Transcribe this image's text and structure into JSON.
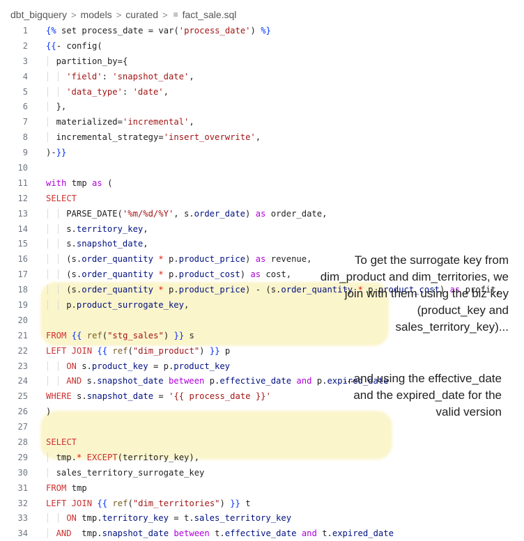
{
  "breadcrumb": {
    "items": [
      "dbt_bigquery",
      "models",
      "curated"
    ],
    "separator": ">",
    "file_icon": "≡",
    "file": "fact_sale.sql"
  },
  "code_lines": [
    {
      "n": "1",
      "indent": 0,
      "tokens": [
        [
          "t-br",
          "{%"
        ],
        [
          "t-plain",
          " set process_date = var("
        ],
        [
          "t-str",
          "'process_date'"
        ],
        [
          "t-plain",
          ") "
        ],
        [
          "t-br",
          "%}"
        ]
      ]
    },
    {
      "n": "2",
      "indent": 0,
      "tokens": [
        [
          "t-br",
          "{{"
        ],
        [
          "t-plain",
          "- config("
        ]
      ]
    },
    {
      "n": "3",
      "indent": 1,
      "tokens": [
        [
          "t-plain",
          "partition_by={"
        ]
      ]
    },
    {
      "n": "4",
      "indent": 2,
      "tokens": [
        [
          "t-str",
          "'field'"
        ],
        [
          "t-plain",
          ": "
        ],
        [
          "t-str",
          "'snapshot_date'"
        ],
        [
          "t-plain",
          ","
        ]
      ]
    },
    {
      "n": "5",
      "indent": 2,
      "tokens": [
        [
          "t-str",
          "'data_type'"
        ],
        [
          "t-plain",
          ": "
        ],
        [
          "t-str",
          "'date'"
        ],
        [
          "t-plain",
          ","
        ]
      ]
    },
    {
      "n": "6",
      "indent": 1,
      "tokens": [
        [
          "t-plain",
          "},"
        ]
      ]
    },
    {
      "n": "7",
      "indent": 1,
      "tokens": [
        [
          "t-plain",
          "materialized="
        ],
        [
          "t-str",
          "'incremental'"
        ],
        [
          "t-plain",
          ","
        ]
      ]
    },
    {
      "n": "8",
      "indent": 1,
      "tokens": [
        [
          "t-plain",
          "incremental_strategy="
        ],
        [
          "t-str",
          "'insert_overwrite'"
        ],
        [
          "t-plain",
          ","
        ]
      ]
    },
    {
      "n": "9",
      "indent": 0,
      "tokens": [
        [
          "t-plain",
          ")-"
        ],
        [
          "t-br",
          "}}"
        ]
      ]
    },
    {
      "n": "10",
      "indent": 0,
      "tokens": []
    },
    {
      "n": "11",
      "indent": 0,
      "tokens": [
        [
          "t-kw",
          "with"
        ],
        [
          "t-plain",
          " tmp "
        ],
        [
          "t-kw",
          "as"
        ],
        [
          "t-plain",
          " ("
        ]
      ]
    },
    {
      "n": "12",
      "indent": 0,
      "tokens": [
        [
          "t-red",
          "SELECT"
        ]
      ]
    },
    {
      "n": "13",
      "indent": 2,
      "tokens": [
        [
          "t-plain",
          "PARSE_DATE("
        ],
        [
          "t-str",
          "'%m/%d/%Y'"
        ],
        [
          "t-plain",
          ", s."
        ],
        [
          "t-var",
          "order_date"
        ],
        [
          "t-plain",
          ") "
        ],
        [
          "t-kw",
          "as"
        ],
        [
          "t-plain",
          " order_date,"
        ]
      ]
    },
    {
      "n": "14",
      "indent": 2,
      "tokens": [
        [
          "t-plain",
          "s."
        ],
        [
          "t-var",
          "territory_key"
        ],
        [
          "t-plain",
          ","
        ]
      ]
    },
    {
      "n": "15",
      "indent": 2,
      "tokens": [
        [
          "t-plain",
          "s."
        ],
        [
          "t-var",
          "snapshot_date"
        ],
        [
          "t-plain",
          ","
        ]
      ]
    },
    {
      "n": "16",
      "indent": 2,
      "tokens": [
        [
          "t-plain",
          "(s."
        ],
        [
          "t-var",
          "order_quantity"
        ],
        [
          "t-op",
          " * "
        ],
        [
          "t-plain",
          "p."
        ],
        [
          "t-var",
          "product_price"
        ],
        [
          "t-plain",
          ") "
        ],
        [
          "t-kw",
          "as"
        ],
        [
          "t-plain",
          " revenue,"
        ]
      ]
    },
    {
      "n": "17",
      "indent": 2,
      "tokens": [
        [
          "t-plain",
          "(s."
        ],
        [
          "t-var",
          "order_quantity"
        ],
        [
          "t-op",
          " * "
        ],
        [
          "t-plain",
          "p."
        ],
        [
          "t-var",
          "product_cost"
        ],
        [
          "t-plain",
          ") "
        ],
        [
          "t-kw",
          "as"
        ],
        [
          "t-plain",
          " cost,"
        ]
      ]
    },
    {
      "n": "18",
      "indent": 2,
      "tokens": [
        [
          "t-plain",
          "(s."
        ],
        [
          "t-var",
          "order_quantity"
        ],
        [
          "t-op",
          " * "
        ],
        [
          "t-plain",
          "p."
        ],
        [
          "t-var",
          "product_price"
        ],
        [
          "t-plain",
          ") - (s."
        ],
        [
          "t-var",
          "order_quantity"
        ],
        [
          "t-op",
          " * "
        ],
        [
          "t-plain",
          "p."
        ],
        [
          "t-var",
          "product_cost"
        ],
        [
          "t-plain",
          ") "
        ],
        [
          "t-kw",
          "as"
        ],
        [
          "t-plain",
          " profit,"
        ]
      ]
    },
    {
      "n": "19",
      "indent": 2,
      "tokens": [
        [
          "t-plain",
          "p."
        ],
        [
          "t-var",
          "product_surrogate_key"
        ],
        [
          "t-plain",
          ","
        ]
      ]
    },
    {
      "n": "20",
      "indent": 0,
      "tokens": []
    },
    {
      "n": "21",
      "indent": 0,
      "tokens": [
        [
          "t-red",
          "FROM"
        ],
        [
          "t-plain",
          " "
        ],
        [
          "t-br",
          "{{"
        ],
        [
          "t-plain",
          " "
        ],
        [
          "t-fn",
          "ref"
        ],
        [
          "t-plain",
          "("
        ],
        [
          "t-str",
          "\"stg_sales\""
        ],
        [
          "t-plain",
          ") "
        ],
        [
          "t-br",
          "}}"
        ],
        [
          "t-plain",
          " s"
        ]
      ]
    },
    {
      "n": "22",
      "indent": 0,
      "tokens": [
        [
          "t-red",
          "LEFT JOIN"
        ],
        [
          "t-plain",
          " "
        ],
        [
          "t-br",
          "{{"
        ],
        [
          "t-plain",
          " "
        ],
        [
          "t-fn",
          "ref"
        ],
        [
          "t-plain",
          "("
        ],
        [
          "t-str",
          "\"dim_product\""
        ],
        [
          "t-plain",
          ") "
        ],
        [
          "t-br",
          "}}"
        ],
        [
          "t-plain",
          " p"
        ]
      ]
    },
    {
      "n": "23",
      "indent": 2,
      "tokens": [
        [
          "t-red",
          "ON"
        ],
        [
          "t-plain",
          " s."
        ],
        [
          "t-var",
          "product_key"
        ],
        [
          "t-plain",
          " = p."
        ],
        [
          "t-var",
          "product_key"
        ]
      ]
    },
    {
      "n": "24",
      "indent": 2,
      "tokens": [
        [
          "t-red",
          "AND"
        ],
        [
          "t-plain",
          " s."
        ],
        [
          "t-var",
          "snapshot_date"
        ],
        [
          "t-plain",
          " "
        ],
        [
          "t-kw",
          "between"
        ],
        [
          "t-plain",
          " p."
        ],
        [
          "t-var",
          "effective_date"
        ],
        [
          "t-plain",
          " "
        ],
        [
          "t-kw",
          "and"
        ],
        [
          "t-plain",
          " p."
        ],
        [
          "t-var",
          "expired_date"
        ]
      ]
    },
    {
      "n": "25",
      "indent": 0,
      "tokens": [
        [
          "t-red",
          "WHERE"
        ],
        [
          "t-plain",
          " s."
        ],
        [
          "t-var",
          "snapshot_date"
        ],
        [
          "t-plain",
          " = "
        ],
        [
          "t-str",
          "'{{ process_date }}'"
        ]
      ]
    },
    {
      "n": "26",
      "indent": 0,
      "tokens": [
        [
          "t-plain",
          ")"
        ]
      ]
    },
    {
      "n": "27",
      "indent": 0,
      "tokens": []
    },
    {
      "n": "28",
      "indent": 0,
      "tokens": [
        [
          "t-red",
          "SELECT"
        ]
      ]
    },
    {
      "n": "29",
      "indent": 1,
      "tokens": [
        [
          "t-plain",
          "tmp."
        ],
        [
          "t-op",
          "*"
        ],
        [
          "t-plain",
          " "
        ],
        [
          "t-red",
          "EXCEPT"
        ],
        [
          "t-plain",
          "(territory_key),"
        ]
      ]
    },
    {
      "n": "30",
      "indent": 1,
      "tokens": [
        [
          "t-plain",
          "sales_territory_surrogate_key"
        ]
      ]
    },
    {
      "n": "31",
      "indent": 0,
      "tokens": [
        [
          "t-red",
          "FROM"
        ],
        [
          "t-plain",
          " tmp"
        ]
      ]
    },
    {
      "n": "32",
      "indent": 0,
      "tokens": [
        [
          "t-red",
          "LEFT JOIN"
        ],
        [
          "t-plain",
          " "
        ],
        [
          "t-br",
          "{{"
        ],
        [
          "t-plain",
          " "
        ],
        [
          "t-fn",
          "ref"
        ],
        [
          "t-plain",
          "("
        ],
        [
          "t-str",
          "\"dim_territories\""
        ],
        [
          "t-plain",
          ") "
        ],
        [
          "t-br",
          "}}"
        ],
        [
          "t-plain",
          " t"
        ]
      ]
    },
    {
      "n": "33",
      "indent": 2,
      "tokens": [
        [
          "t-red",
          "ON"
        ],
        [
          "t-plain",
          " tmp."
        ],
        [
          "t-var",
          "territory_key"
        ],
        [
          "t-plain",
          " = t."
        ],
        [
          "t-var",
          "sales_territory_key"
        ]
      ]
    },
    {
      "n": "34",
      "indent": 1,
      "tokens": [
        [
          "t-red",
          "AND"
        ],
        [
          "t-plain",
          "  tmp."
        ],
        [
          "t-var",
          "snapshot_date"
        ],
        [
          "t-plain",
          " "
        ],
        [
          "t-kw",
          "between"
        ],
        [
          "t-plain",
          " t."
        ],
        [
          "t-var",
          "effective_date"
        ],
        [
          "t-plain",
          " "
        ],
        [
          "t-kw",
          "and"
        ],
        [
          "t-plain",
          " t."
        ],
        [
          "t-var",
          "expired_date"
        ]
      ]
    }
  ],
  "annotations": {
    "note1": "To get the surrogate key from\ndim_product and dim_territories, we\njoin with them using the biz key\n(product_key and\nsales_territory_key)...",
    "note2": "...and using the effective_date\nand the expired_date for the\nvalid version"
  },
  "colors": {
    "highlight": "#fbf5cc",
    "keyword": "#af00db",
    "sql_keyword": "#cd3131",
    "string": "#a31515",
    "field": "#001080"
  }
}
